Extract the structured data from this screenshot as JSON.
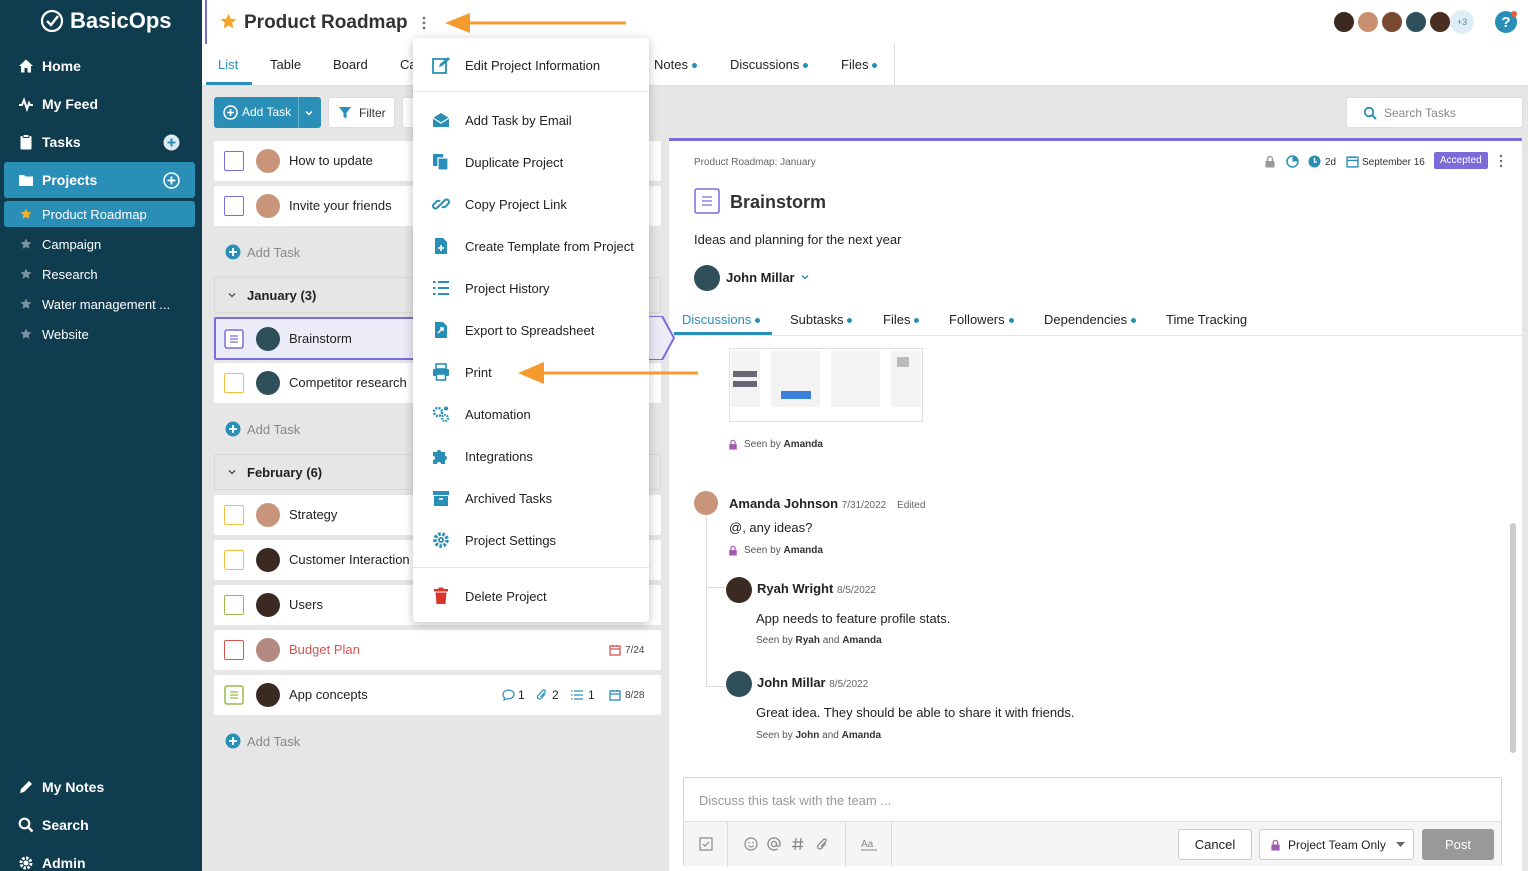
{
  "app": {
    "name": "BasicOps"
  },
  "sidebar": {
    "nav": [
      {
        "label": "Home",
        "icon": "home-icon"
      },
      {
        "label": "My Feed",
        "icon": "pulse-icon"
      },
      {
        "label": "Tasks",
        "icon": "clipboard-icon"
      },
      {
        "label": "Projects",
        "icon": "folder-icon"
      }
    ],
    "projects": [
      "Product Roadmap",
      "Campaign",
      "Research",
      "Water management ...",
      "Website"
    ],
    "bottom": [
      {
        "label": "My Notes",
        "icon": "pencil-icon"
      },
      {
        "label": "Search",
        "icon": "search-icon"
      },
      {
        "label": "Admin",
        "icon": "gear-icon"
      }
    ]
  },
  "header": {
    "title": "Product Roadmap",
    "tabs": [
      "List",
      "Table",
      "Board",
      "Ca",
      "Notes",
      "Discussions",
      "Files"
    ],
    "avatars_more": "+3"
  },
  "toolbar": {
    "add_task": "Add Task",
    "filter": "Filter",
    "search_placeholder": "Search Tasks"
  },
  "tasks": {
    "top": [
      {
        "name": "How to update"
      },
      {
        "name": "Invite your friends"
      }
    ],
    "add_task": "Add Task",
    "groups": [
      {
        "label": "January (3)",
        "tasks": [
          {
            "name": "Brainstorm"
          },
          {
            "name": "Competitor research"
          }
        ]
      },
      {
        "label": "February (6)",
        "tasks": [
          {
            "name": "Strategy"
          },
          {
            "name": "Customer Interaction"
          },
          {
            "name": "Users"
          },
          {
            "name": "Budget Plan",
            "date": "7/24"
          },
          {
            "name": "App concepts",
            "comments": "1",
            "attachments": "2",
            "subtasks": "1",
            "date": "8/28"
          }
        ]
      }
    ]
  },
  "menu": {
    "items": [
      {
        "label": "Edit Project Information",
        "icon": "edit-icon"
      },
      {
        "label": "Add Task by Email",
        "icon": "email-icon"
      },
      {
        "label": "Duplicate Project",
        "icon": "duplicate-icon"
      },
      {
        "label": "Copy Project Link",
        "icon": "link-icon"
      },
      {
        "label": "Create Template from Project",
        "icon": "template-icon"
      },
      {
        "label": "Project History",
        "icon": "list-icon"
      },
      {
        "label": "Export to Spreadsheet",
        "icon": "export-icon"
      },
      {
        "label": "Print",
        "icon": "printer-icon"
      },
      {
        "label": "Automation",
        "icon": "automation-icon"
      },
      {
        "label": "Integrations",
        "icon": "puzzle-icon"
      },
      {
        "label": "Archived Tasks",
        "icon": "archive-icon"
      },
      {
        "label": "Project Settings",
        "icon": "gear-icon"
      },
      {
        "label": "Delete Project",
        "icon": "trash-icon"
      }
    ]
  },
  "detail": {
    "breadcrumb": "Product Roadmap: January",
    "duration": "2d",
    "due_date": "September 16",
    "status": "Accepted",
    "title": "Brainstorm",
    "description": "Ideas and planning for the next year",
    "assignee": "John Millar",
    "tabs": [
      "Discussions",
      "Subtasks",
      "Files",
      "Followers",
      "Dependencies",
      "Time Tracking"
    ],
    "seen_top": {
      "prefix": "Seen by",
      "names": "Amanda"
    },
    "comments": [
      {
        "author": "Amanda Johnson",
        "date": "7/31/2022",
        "edited": "Edited",
        "text": "@, any ideas?",
        "seen_prefix": "Seen by",
        "seen": "Amanda"
      },
      {
        "author": "Ryah Wright",
        "date": "8/5/2022",
        "text": "App needs to feature profile stats.",
        "seen_prefix": "Seen by",
        "seen_a": "Ryah",
        "seen_and": "and",
        "seen_b": "Amanda"
      },
      {
        "author": "John Millar",
        "date": "8/5/2022",
        "text": "Great idea. They should be able to share it with friends.",
        "seen_prefix": "Seen by",
        "seen_a": "John",
        "seen_and": "and",
        "seen_b": "Amanda"
      }
    ],
    "composer": {
      "placeholder": "Discuss this task with the team ...",
      "cancel": "Cancel",
      "visibility": "Project Team Only",
      "post": "Post"
    }
  },
  "colors": {
    "sidebar": "#103c4f",
    "accent": "#2a8fb6",
    "purple": "#7b6cd9",
    "arrow": "#f49a2e",
    "danger": "#d9534f"
  }
}
